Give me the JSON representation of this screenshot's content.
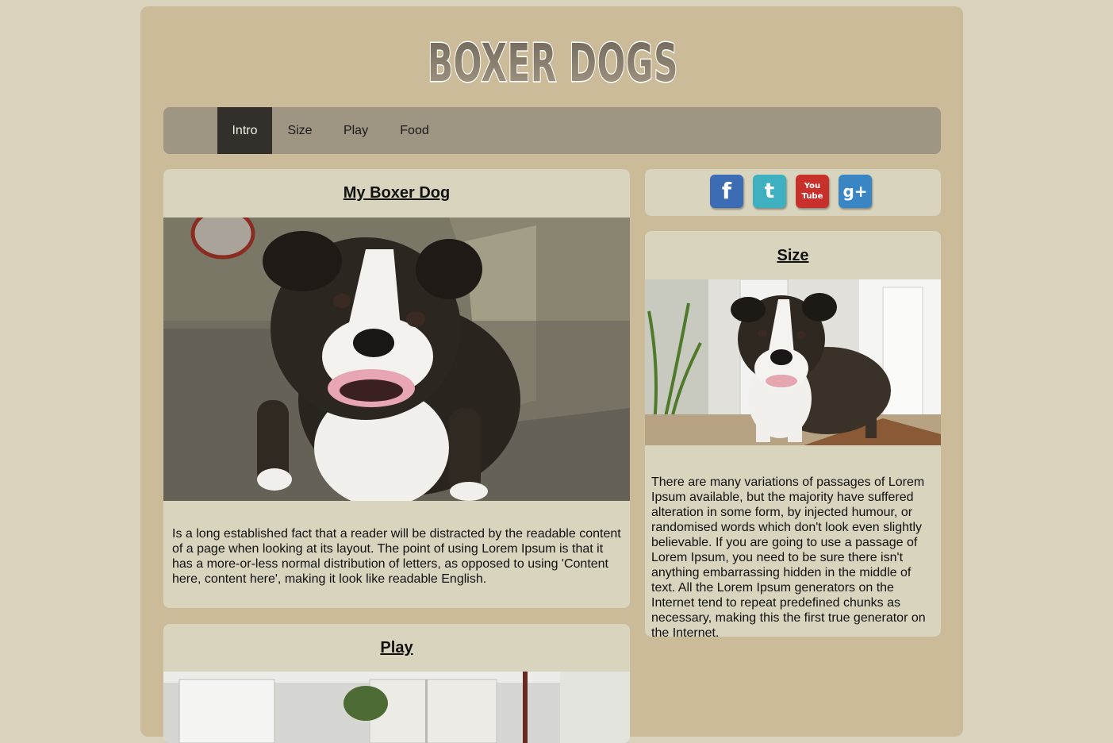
{
  "header": {
    "logo_text": "BOXER DOGS"
  },
  "nav": {
    "items": [
      {
        "label": "Intro",
        "active": true
      },
      {
        "label": "Size",
        "active": false
      },
      {
        "label": "Play",
        "active": false
      },
      {
        "label": "Food",
        "active": false
      }
    ]
  },
  "social": {
    "icons": [
      {
        "name": "facebook-icon",
        "glyph": "f",
        "color": "#3b6cb4"
      },
      {
        "name": "twitter-icon",
        "glyph": "t",
        "color": "#3fb0c0"
      },
      {
        "name": "youtube-icon",
        "glyph": "You Tube",
        "color": "#c8302c"
      },
      {
        "name": "google-plus-icon",
        "glyph": "g+",
        "color": "#3a86c4"
      }
    ]
  },
  "main": {
    "intro": {
      "title": "My Boxer Dog",
      "text": "Is a long established fact that a reader will be distracted by the readable content of a page when looking at its layout. The point of using Lorem Ipsum is that it has a more-or-less normal distribution of letters, as opposed to using 'Content here, content here', making it look like readable English."
    },
    "play": {
      "title": "Play"
    }
  },
  "sidebar": {
    "size": {
      "title": "Size",
      "text": "There are many variations of passages of Lorem Ipsum available, but the majority have suffered alteration in some form, by injected humour, or randomised words which don't look even slightly believable. If you are going to use a passage of Lorem Ipsum, you need to be sure there isn't anything embarrassing hidden in the middle of text. All the Lorem Ipsum generators on the Internet tend to repeat predefined chunks as necessary, making this the first true generator on the Internet."
    }
  }
}
